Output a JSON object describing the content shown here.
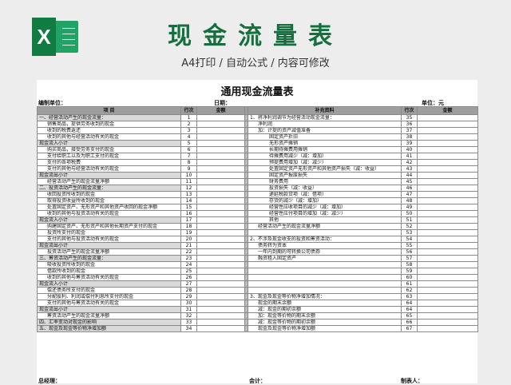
{
  "hero": {
    "title": "现金流量表",
    "subtitle": "A4打印 / 自动公式 / 内容可修改",
    "logo_letter": "X",
    "brand_color": "#107c41"
  },
  "sheet": {
    "title": "通用现金流量表",
    "unit_label": "编制单位：",
    "date_label": "日期：",
    "currency_label": "单位：元",
    "headers": [
      "项  目",
      "行次",
      "金额",
      "补充资料",
      "行次",
      "金额"
    ],
    "left": [
      {
        "text": "一、经营活动产生的现金流量：",
        "row": "1",
        "indent": 0,
        "gray": true
      },
      {
        "text": "销售商品，提供劳务收到的现金",
        "row": "2",
        "indent": 1
      },
      {
        "text": "收到的税费返还",
        "row": "3",
        "indent": 1
      },
      {
        "text": "收到的其他与经营活动有关的现金",
        "row": "4",
        "indent": 1
      },
      {
        "text": "现金流入小计",
        "row": "5",
        "indent": 0,
        "gray": true
      },
      {
        "text": "购买商品，接受劳务支付的现金",
        "row": "6",
        "indent": 1
      },
      {
        "text": "支付给职工以及为职工支付的现金",
        "row": "7",
        "indent": 1
      },
      {
        "text": "支付的各项税费",
        "row": "8",
        "indent": 1
      },
      {
        "text": "支付的其他与经营活动有关的现金",
        "row": "9",
        "indent": 1
      },
      {
        "text": "现金流出小计",
        "row": "10",
        "indent": 0,
        "gray": true
      },
      {
        "text": "经营活动产生的现金流量净额",
        "row": "11",
        "indent": 1
      },
      {
        "text": "二、投资活动产生的现金流量：",
        "row": "12",
        "indent": 0,
        "gray": true
      },
      {
        "text": "收回投资所收到的现金",
        "row": "13",
        "indent": 1
      },
      {
        "text": "取得投资收益所收到的现金",
        "row": "14",
        "indent": 1
      },
      {
        "text": "处置固定资产、无形资产和其他资产收回的现金净额",
        "row": "15",
        "indent": 1
      },
      {
        "text": "收到的其他与投资活动有关的现金",
        "row": "16",
        "indent": 1
      },
      {
        "text": "现金流入小计",
        "row": "17",
        "indent": 0,
        "gray": true
      },
      {
        "text": "购建固定资产、无形资产和其他长期资产支付的现金",
        "row": "18",
        "indent": 1
      },
      {
        "text": "投资所支付的现金",
        "row": "19",
        "indent": 1
      },
      {
        "text": "支付的其他与投资活动有关的现金",
        "row": "20",
        "indent": 1
      },
      {
        "text": "现金流出小计",
        "row": "21",
        "indent": 0,
        "gray": true
      },
      {
        "text": "投资活动产生的现金流量净额",
        "row": "22",
        "indent": 1
      },
      {
        "text": "三、筹资活动产生的现金流量：",
        "row": "23",
        "indent": 0,
        "gray": true
      },
      {
        "text": "吸收投资所收到的现金",
        "row": "24",
        "indent": 1
      },
      {
        "text": "借款所收到的现金",
        "row": "25",
        "indent": 1
      },
      {
        "text": "收到的其他与筹资活动有关的现金",
        "row": "26",
        "indent": 1
      },
      {
        "text": "现金流入小计",
        "row": "27",
        "indent": 0,
        "gray": true
      },
      {
        "text": "偿还债务所支付的现金",
        "row": "28",
        "indent": 1
      },
      {
        "text": "分配股利、利润或偿付利息所支付的现金",
        "row": "29",
        "indent": 1
      },
      {
        "text": "支付的其他与筹资活动有关的现金",
        "row": "30",
        "indent": 1
      },
      {
        "text": "现金流出小计",
        "row": "31",
        "indent": 0,
        "gray": true
      },
      {
        "text": "筹资活动产生的现金流量净额",
        "row": "32",
        "indent": 1
      },
      {
        "text": "四、汇率变动对现金的影响",
        "row": "33",
        "indent": 0,
        "gray": true
      },
      {
        "text": "五、现金及现金等价物净增加额",
        "row": "34",
        "indent": 0,
        "gray": true
      }
    ],
    "right": [
      {
        "text": "1、将净利润调节为经营活动现金流量：",
        "row": "35",
        "indent": 0
      },
      {
        "text": "净利润",
        "row": "36",
        "indent": 1
      },
      {
        "text": "加：计提的资产减值准备",
        "row": "37",
        "indent": 1
      },
      {
        "text": "固定资产折旧",
        "row": "38",
        "indent": 2
      },
      {
        "text": "无形资产摊销",
        "row": "39",
        "indent": 2
      },
      {
        "text": "长期待摊费用摊销",
        "row": "40",
        "indent": 2
      },
      {
        "text": "待摊费用减少（减：增加）",
        "row": "41",
        "indent": 2
      },
      {
        "text": "预提费用增加（减：减少）",
        "row": "42",
        "indent": 2
      },
      {
        "text": "处置固定资产无形资产和其他资产损失（减：收益）",
        "row": "43",
        "indent": 2
      },
      {
        "text": "固定资产报废损失",
        "row": "44",
        "indent": 2
      },
      {
        "text": "财务费用",
        "row": "45",
        "indent": 2
      },
      {
        "text": "投资损失（减：收益）",
        "row": "46",
        "indent": 2
      },
      {
        "text": "递延税款贷项（减：借项）",
        "row": "47",
        "indent": 2
      },
      {
        "text": "存货的减少（减：增加）",
        "row": "48",
        "indent": 2
      },
      {
        "text": "经营性应收项目的减少（减：增加）",
        "row": "49",
        "indent": 2
      },
      {
        "text": "经营性应付项目的增加（减：减少）",
        "row": "50",
        "indent": 2
      },
      {
        "text": "其他",
        "row": "51",
        "indent": 2
      },
      {
        "text": "经营活动产生的现金流量净额",
        "row": "52",
        "indent": 1
      },
      {
        "text": "",
        "row": "53",
        "indent": 0
      },
      {
        "text": "2、不涉及现金收支的投资和筹资活动：",
        "row": "54",
        "indent": 0
      },
      {
        "text": "债务转为资本",
        "row": "55",
        "indent": 1
      },
      {
        "text": "一年内到期的可转换公司债券",
        "row": "56",
        "indent": 1
      },
      {
        "text": "融资租入固定资产",
        "row": "57",
        "indent": 1
      },
      {
        "text": "",
        "row": "58",
        "indent": 0
      },
      {
        "text": "",
        "row": "59",
        "indent": 0
      },
      {
        "text": "",
        "row": "60",
        "indent": 0
      },
      {
        "text": "",
        "row": "61",
        "indent": 0
      },
      {
        "text": "",
        "row": "62",
        "indent": 0
      },
      {
        "text": "3、现金及现金等价物净增加情况：",
        "row": "63",
        "indent": 0
      },
      {
        "text": "现金的期末余额",
        "row": "64",
        "indent": 1
      },
      {
        "text": "减：现金的期初余额",
        "row": "64",
        "indent": 1
      },
      {
        "text": "加：现金等价物的期末余额",
        "row": "65",
        "indent": 1
      },
      {
        "text": "减：现金等价物的期初余额",
        "row": "66",
        "indent": 1
      },
      {
        "text": "现金及现金等价物净增加额",
        "row": "67",
        "indent": 1
      }
    ],
    "footer": {
      "manager": "总经理：",
      "accountant": "会计：",
      "preparer": "制表人："
    }
  }
}
